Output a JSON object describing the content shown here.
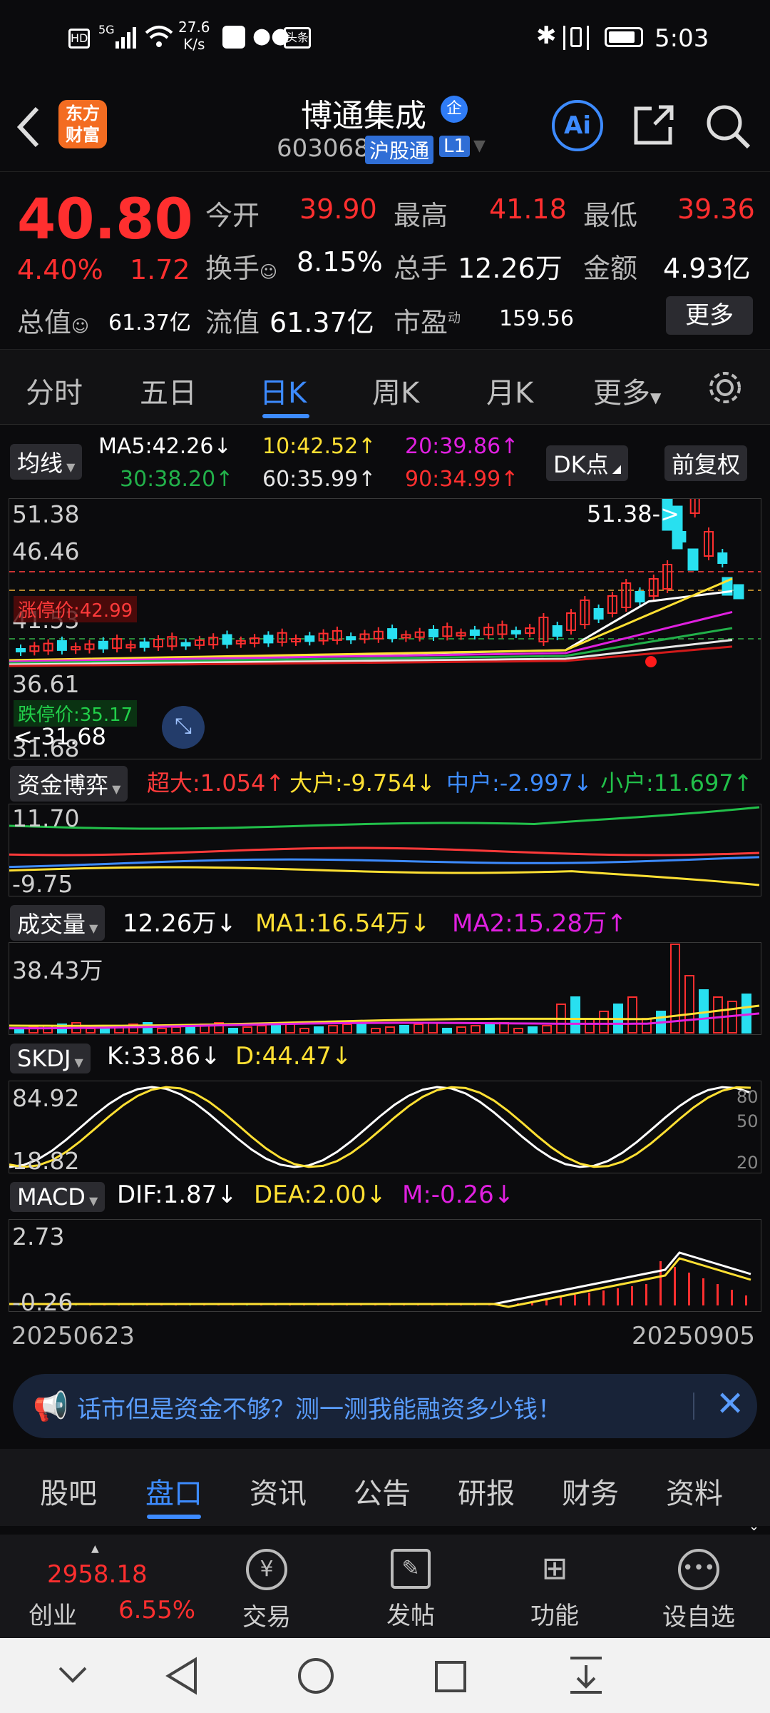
{
  "status": {
    "time": "5:03",
    "net_speed": "27.6",
    "net_unit": "K/s",
    "net_label": "5G",
    "app1": "头条"
  },
  "header": {
    "brand_line1": "东方",
    "brand_line2": "财富",
    "stock_name": "博通集成",
    "badge": "企",
    "code": "603068",
    "market": "沪股通",
    "level": "L1"
  },
  "quote": {
    "price": "40.80",
    "pct": "4.40%",
    "chg": "1.72",
    "open_label": "今开",
    "open": "39.90",
    "high_label": "最高",
    "high": "41.18",
    "low_label": "最低",
    "low": "39.36",
    "turn_label": "换手",
    "turn": "8.15%",
    "vol_label": "总手",
    "vol": "12.26万",
    "amt_label": "金额",
    "amt": "4.93亿",
    "mcap_label": "总值",
    "mcap": "61.37亿",
    "float_label": "流值",
    "float": "61.37亿",
    "pe_label": "市盈",
    "pe_sup": "动",
    "pe": "159.56",
    "more": "更多"
  },
  "tabs": [
    "分时",
    "五日",
    "日K",
    "周K",
    "月K",
    "更多"
  ],
  "ma": {
    "label": "均线",
    "ma5": "MA5:42.26",
    "ma10": "10:42.52",
    "ma20": "20:39.86",
    "ma30": "30:38.20",
    "ma60": "60:35.99",
    "ma90": "90:34.99",
    "dk": "DK点",
    "fq": "前复权"
  },
  "kline": {
    "y1": "51.38",
    "y2": "46.46",
    "y3": "41.53",
    "y4": "36.61",
    "y5": "31.68",
    "limit_up": "涨停价:42.99",
    "limit_down": "跌停价:35.17",
    "max_tag": "51.38->",
    "min_tag": "<-31.68"
  },
  "fund": {
    "label": "资金博弈",
    "sd": "超大:1.054",
    "dh": "大户:-9.754",
    "zh": "中户:-2.997",
    "xh": "小户:11.697",
    "ymax": "11.70",
    "ymin": "-9.75"
  },
  "volume": {
    "label": "成交量",
    "cur": "12.26万",
    "ma1": "MA1:16.54万",
    "ma2": "MA2:15.28万",
    "ymax": "38.43万"
  },
  "skdj": {
    "label": "SKDJ",
    "k": "K:33.86",
    "d": "D:44.47",
    "ymax": "84.92",
    "ymin": "18.82",
    "r80": "80",
    "r50": "50",
    "r20": "20"
  },
  "macd": {
    "label": "MACD",
    "dif": "DIF:1.87",
    "dea": "DEA:2.00",
    "m": "M:-0.26",
    "ymax": "2.73",
    "ymin": "-0.26"
  },
  "dates": {
    "start": "20250623",
    "end": "20250905"
  },
  "banner": {
    "text": "话市但是资金不够？测一测我能融资多少钱！"
  },
  "subtabs": [
    "股吧",
    "盘口",
    "资讯",
    "公告",
    "研报",
    "财务",
    "资料"
  ],
  "bottom": {
    "index_val": "2958.18",
    "index_name": "创业",
    "index_pct": "6.55%",
    "b1": "交易",
    "b2": "发帖",
    "b3": "功能",
    "b4": "设自选"
  },
  "colors": {
    "up": "#ff2f2f",
    "down": "#28e0f0",
    "accent": "#3d8bff",
    "ma5": "#ffffff",
    "ma10": "#ffe033",
    "ma20": "#e020e0",
    "ma30": "#22b04a",
    "ma60": "#e6e6e6",
    "ma90": "#d11a1a"
  }
}
